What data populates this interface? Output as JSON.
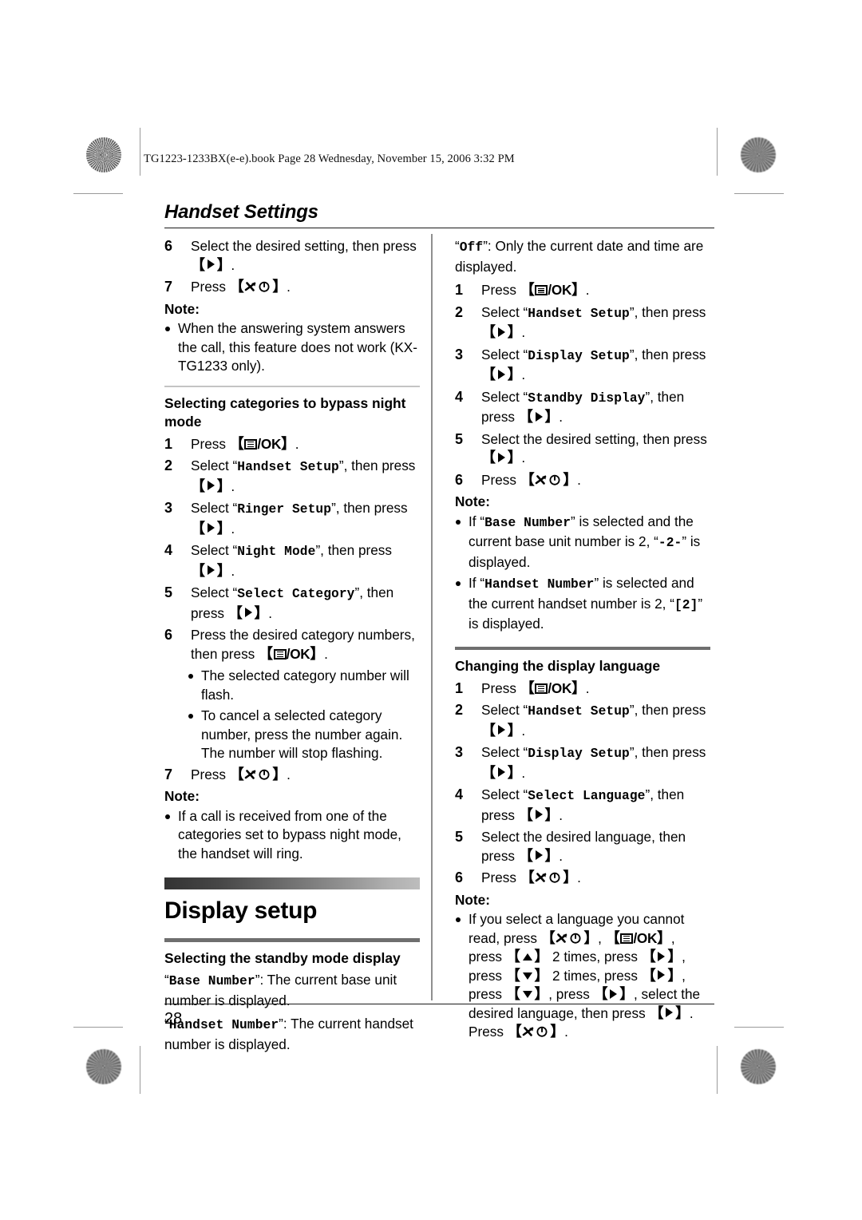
{
  "page": {
    "file_header": "TG1223-1233BX(e-e).book  Page 28  Wednesday, November 15, 2006  3:32 PM",
    "section_title": "Handset Settings",
    "page_number": "28"
  },
  "icons": {
    "right_arrow": "right-arrow-key-icon",
    "up_arrow": "up-arrow-key-icon",
    "down_arrow": "down-arrow-key-icon",
    "menu_ok": "menu-ok-key-icon",
    "power_off": "power-off-key-icon",
    "registration": "registration-crosshair-icon",
    "rosette": "print-rosette-icon"
  },
  "left_column": {
    "steps_top": [
      {
        "num": "6",
        "text_before": "Select the desired setting, then press ",
        "key": "right",
        "text_after": "."
      },
      {
        "num": "7",
        "text_before": "Press ",
        "key": "power",
        "text_after": "."
      }
    ],
    "note_label_1": "Note:",
    "note_bullets_1": [
      "When the answering system answers the call, this feature does not work (KX-TG1233 only)."
    ],
    "subhead_bypass": "Selecting categories to bypass night mode",
    "steps_bypass": [
      {
        "num": "1",
        "pre": "Press ",
        "key": "menu",
        "post": "."
      },
      {
        "num": "2",
        "pre": "Select “",
        "mono": "Handset Setup",
        "mid": "”, then press ",
        "key": "right",
        "post": "."
      },
      {
        "num": "3",
        "pre": "Select “",
        "mono": "Ringer Setup",
        "mid": "”, then press ",
        "key": "right",
        "post": "."
      },
      {
        "num": "4",
        "pre": "Select “",
        "mono": "Night Mode",
        "mid": "”, then press ",
        "key": "right",
        "post": "."
      },
      {
        "num": "5",
        "pre": "Select “",
        "mono": "Select Category",
        "mid": "”, then press ",
        "key": "right",
        "post": "."
      },
      {
        "num": "6",
        "pre": "Press the desired category numbers, then press ",
        "key": "menu",
        "post": "."
      }
    ],
    "sub_bullets_step6": [
      "The selected category number will flash.",
      "To cancel a selected category number, press the number again. The number will stop flashing."
    ],
    "step7": {
      "num": "7",
      "pre": "Press ",
      "key": "power",
      "post": "."
    },
    "note_label_2": "Note:",
    "note_bullets_2": [
      "If a call is received from one of the categories set to bypass night mode, the handset will ring."
    ],
    "display_setup_heading": "Display setup",
    "standby_subhead": "Selecting the standby mode display",
    "standby_defs": [
      {
        "term": "Base Number",
        "desc": ": The current base unit number is displayed."
      },
      {
        "term": "Handset Number",
        "desc": ": The current handset number is displayed."
      }
    ]
  },
  "right_column": {
    "off_def": {
      "term": "Off",
      "desc": ": Only the current date and time are displayed."
    },
    "steps_standby": [
      {
        "num": "1",
        "pre": "Press ",
        "key": "menu",
        "post": "."
      },
      {
        "num": "2",
        "pre": "Select “",
        "mono": "Handset Setup",
        "mid": "”, then press ",
        "key": "right",
        "post": "."
      },
      {
        "num": "3",
        "pre": "Select “",
        "mono": "Display Setup",
        "mid": "”, then press ",
        "key": "right",
        "post": "."
      },
      {
        "num": "4",
        "pre": "Select “",
        "mono": "Standby Display",
        "mid": "”, then press ",
        "key": "right",
        "post": "."
      },
      {
        "num": "5",
        "pre": "Select the desired setting, then press ",
        "key": "right",
        "post": "."
      },
      {
        "num": "6",
        "pre": "Press ",
        "key": "power",
        "post": "."
      }
    ],
    "note_label_1": "Note:",
    "note_bullet_base": {
      "p1": "If “",
      "term1": "Base Number",
      "p2": "” is selected and the current base unit number is 2, “",
      "term2": "-2-",
      "p3": "” is displayed."
    },
    "note_bullet_handset": {
      "p1": "If “",
      "term1": "Handset Number",
      "p2": "” is selected and the current handset number is 2, “",
      "term2": "[2]",
      "p3": "” is displayed."
    },
    "language_subhead": "Changing the display language",
    "steps_language": [
      {
        "num": "1",
        "pre": "Press ",
        "key": "menu",
        "post": "."
      },
      {
        "num": "2",
        "pre": "Select “",
        "mono": "Handset Setup",
        "mid": "”, then press ",
        "key": "right",
        "post": "."
      },
      {
        "num": "3",
        "pre": "Select “",
        "mono": "Display Setup",
        "mid": "”, then press ",
        "key": "right",
        "post": "."
      },
      {
        "num": "4",
        "pre": "Select “",
        "mono": "Select Language",
        "mid": "”, then press ",
        "key": "right",
        "post": "."
      },
      {
        "num": "5",
        "pre": "Select the desired language, then press ",
        "key": "right",
        "post": "."
      },
      {
        "num": "6",
        "pre": "Press ",
        "key": "power",
        "post": "."
      }
    ],
    "note_label_2": "Note:",
    "note_language": {
      "s1": "If you select a language you cannot read, press ",
      "s2": ", ",
      "s3": ", press ",
      "s4": " 2 times, press ",
      "s5": ", press ",
      "s6": " 2 times, press ",
      "s7": ", press ",
      "s8": ", press ",
      "s9": ", select the desired language, then press ",
      "s10": ". Press ",
      "s11": "."
    }
  }
}
